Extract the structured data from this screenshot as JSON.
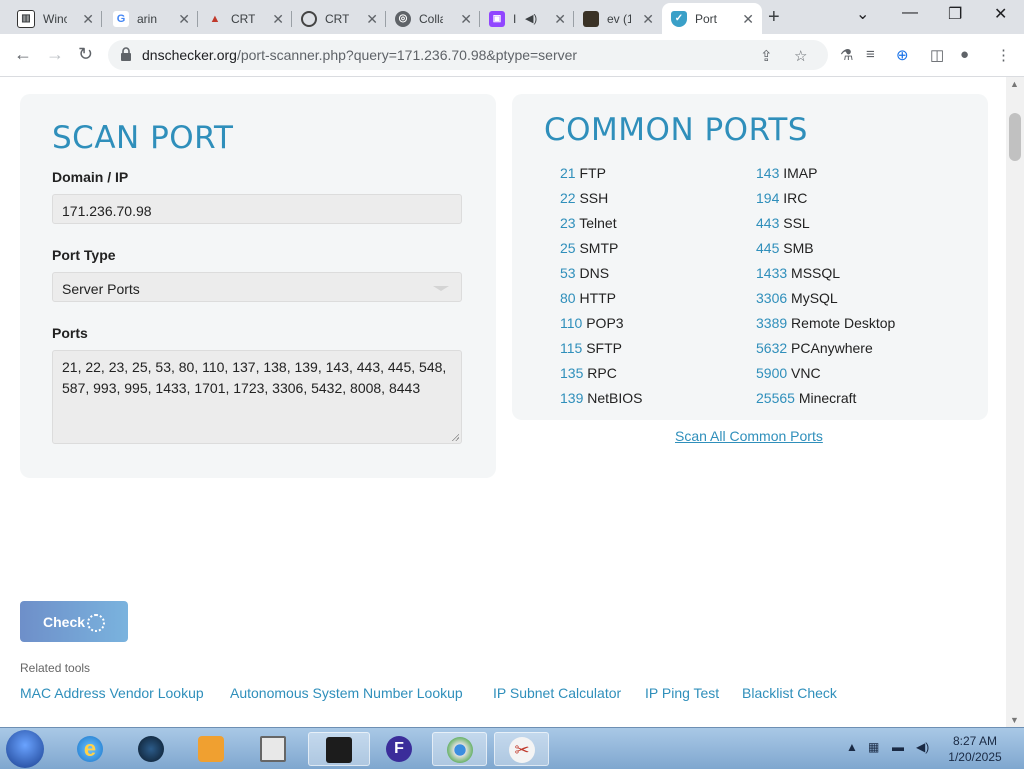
{
  "browser": {
    "tabs": [
      {
        "title": "Winc"
      },
      {
        "title": "arin"
      },
      {
        "title": "CRT"
      },
      {
        "title": "CRT"
      },
      {
        "title": "Colla"
      },
      {
        "title": "I"
      },
      {
        "title": "ev (1"
      },
      {
        "title": "Port"
      }
    ],
    "url_domain": "dnschecker.org",
    "url_path": "/port-scanner.php?query=171.236.70.98&ptype=server"
  },
  "scan_port": {
    "title": "SCAN PORT",
    "domain_label": "Domain / IP",
    "domain_value": "171.236.70.98",
    "port_type_label": "Port Type",
    "port_type_value": "Server Ports",
    "ports_label": "Ports",
    "ports_value": "21, 22, 23, 25, 53, 80, 110, 137, 138, 139, 143, 443, 445, 548, 587, 993, 995, 1433, 1701, 1723, 3306, 5432, 8008, 8443"
  },
  "common_ports": {
    "title": "COMMON PORTS",
    "left": [
      {
        "port": "21",
        "service": "FTP"
      },
      {
        "port": "22",
        "service": "SSH"
      },
      {
        "port": "23",
        "service": "Telnet"
      },
      {
        "port": "25",
        "service": "SMTP"
      },
      {
        "port": "53",
        "service": "DNS"
      },
      {
        "port": "80",
        "service": "HTTP"
      },
      {
        "port": "110",
        "service": "POP3"
      },
      {
        "port": "115",
        "service": "SFTP"
      },
      {
        "port": "135",
        "service": "RPC"
      },
      {
        "port": "139",
        "service": "NetBIOS"
      }
    ],
    "right": [
      {
        "port": "143",
        "service": "IMAP"
      },
      {
        "port": "194",
        "service": "IRC"
      },
      {
        "port": "443",
        "service": "SSL"
      },
      {
        "port": "445",
        "service": "SMB"
      },
      {
        "port": "1433",
        "service": "MSSQL"
      },
      {
        "port": "3306",
        "service": "MySQL"
      },
      {
        "port": "3389",
        "service": "Remote Desktop"
      },
      {
        "port": "5632",
        "service": "PCAnywhere"
      },
      {
        "port": "5900",
        "service": "VNC"
      },
      {
        "port": "25565",
        "service": "Minecraft"
      }
    ],
    "scan_all_link": "Scan All Common Ports"
  },
  "check_button": "Check",
  "related": {
    "label": "Related tools",
    "links": [
      "MAC Address Vendor Lookup",
      "Autonomous System Number Lookup",
      "IP Subnet Calculator",
      "IP Ping Test",
      "Blacklist Check"
    ]
  },
  "taskbar": {
    "time": "8:27 AM",
    "date": "1/20/2025"
  },
  "colors": {
    "accent": "#2f8fbb",
    "card_bg": "#f4f6f7",
    "button_gradient_start": "#6e8fc9",
    "button_gradient_end": "#7ab3de"
  }
}
